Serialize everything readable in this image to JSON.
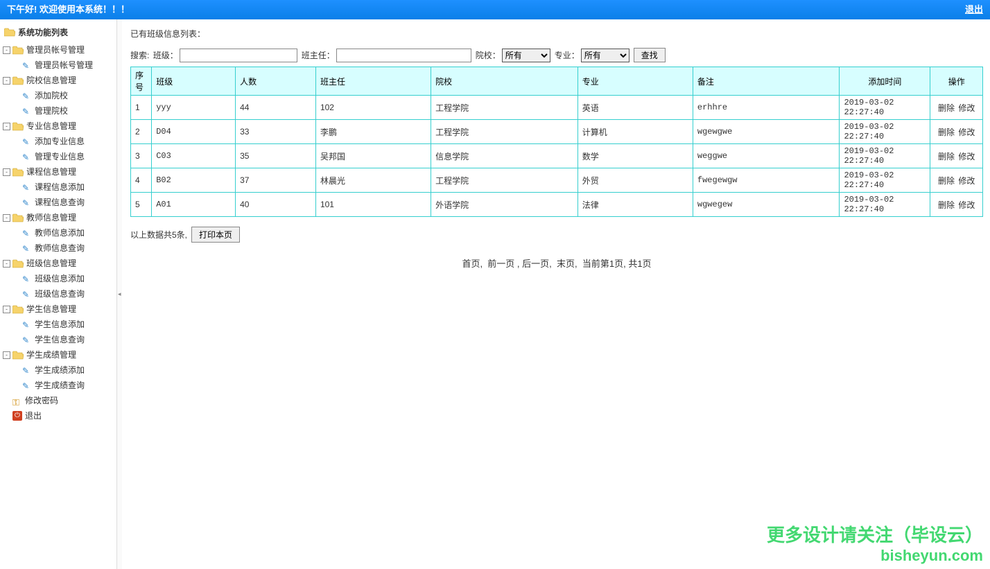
{
  "topbar": {
    "greeting": "下午好! 欢迎使用本系统！！！",
    "logout": "退出"
  },
  "sidebar": {
    "title": "系统功能列表",
    "groups": [
      {
        "label": "管理员帐号管理",
        "children": [
          {
            "label": "管理员帐号管理"
          }
        ]
      },
      {
        "label": "院校信息管理",
        "children": [
          {
            "label": "添加院校"
          },
          {
            "label": "管理院校"
          }
        ]
      },
      {
        "label": "专业信息管理",
        "children": [
          {
            "label": "添加专业信息"
          },
          {
            "label": "管理专业信息"
          }
        ]
      },
      {
        "label": "课程信息管理",
        "children": [
          {
            "label": "课程信息添加"
          },
          {
            "label": "课程信息查询"
          }
        ]
      },
      {
        "label": "教师信息管理",
        "children": [
          {
            "label": "教师信息添加"
          },
          {
            "label": "教师信息查询"
          }
        ]
      },
      {
        "label": "班级信息管理",
        "children": [
          {
            "label": "班级信息添加"
          },
          {
            "label": "班级信息查询"
          }
        ]
      },
      {
        "label": "学生信息管理",
        "children": [
          {
            "label": "学生信息添加"
          },
          {
            "label": "学生信息查询"
          }
        ]
      },
      {
        "label": "学生成绩管理",
        "children": [
          {
            "label": "学生成绩添加"
          },
          {
            "label": "学生成绩查询"
          }
        ]
      }
    ],
    "extra": [
      {
        "icon": "key",
        "label": "修改密码"
      },
      {
        "icon": "exit",
        "label": "退出"
      }
    ]
  },
  "main": {
    "list_title": "已有班级信息列表：",
    "search": {
      "search_label": "搜索:",
      "class_label": "班级：",
      "head_label": "班主任：",
      "school_label": "院校：",
      "major_label": "专业：",
      "option_all": "所有",
      "find_button": "查找"
    },
    "table": {
      "headers": {
        "idx": "序号",
        "class": "班级",
        "count": "人数",
        "head": "班主任",
        "school": "院校",
        "major": "专业",
        "remark": "备注",
        "time": "添加时间",
        "op": "操作"
      },
      "op_delete": "删除",
      "op_edit": "修改",
      "rows": [
        {
          "idx": "1",
          "class": "yyy",
          "count": "44",
          "head": "102",
          "school": "工程学院",
          "major": "英语",
          "remark": "erhhre",
          "time": "2019-03-02 22:27:40"
        },
        {
          "idx": "2",
          "class": "D04",
          "count": "33",
          "head": "李鹏",
          "school": "工程学院",
          "major": "计算机",
          "remark": "wgewgwe",
          "time": "2019-03-02 22:27:40"
        },
        {
          "idx": "3",
          "class": "C03",
          "count": "35",
          "head": "吴邦国",
          "school": "信息学院",
          "major": "数学",
          "remark": "weggwe",
          "time": "2019-03-02 22:27:40"
        },
        {
          "idx": "4",
          "class": "B02",
          "count": "37",
          "head": "林晨光",
          "school": "工程学院",
          "major": "外贸",
          "remark": "fwegewgw",
          "time": "2019-03-02 22:27:40"
        },
        {
          "idx": "5",
          "class": "A01",
          "count": "40",
          "head": "101",
          "school": "外语学院",
          "major": "法律",
          "remark": "wgwegew",
          "time": "2019-03-02 22:27:40"
        }
      ]
    },
    "summary": {
      "text": "以上数据共5条,",
      "print_button": "打印本页"
    },
    "pager": {
      "first": "首页,",
      "prev": "前一页 ,",
      "next": "后一页,",
      "last": "末页,",
      "status": "当前第1页, 共1页"
    }
  },
  "watermark": {
    "line1": "更多设计请关注（毕设云）",
    "line2": "bisheyun.com"
  }
}
